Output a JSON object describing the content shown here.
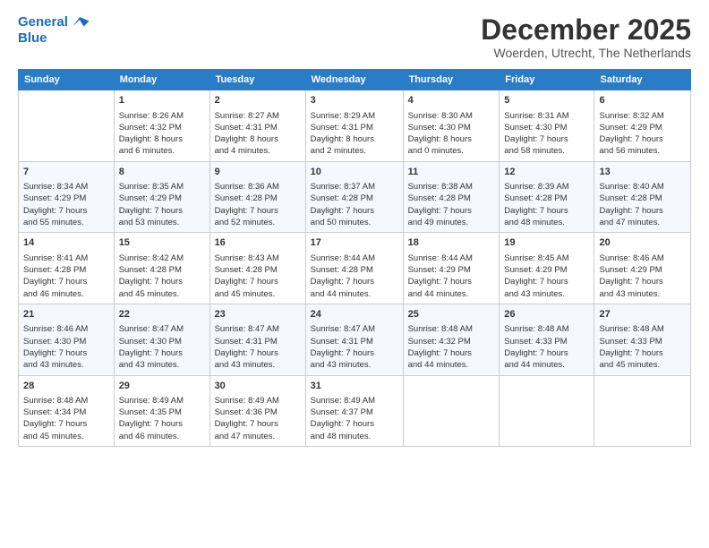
{
  "header": {
    "logo_line1": "General",
    "logo_line2": "Blue",
    "month_title": "December 2025",
    "subtitle": "Woerden, Utrecht, The Netherlands"
  },
  "days_of_week": [
    "Sunday",
    "Monday",
    "Tuesday",
    "Wednesday",
    "Thursday",
    "Friday",
    "Saturday"
  ],
  "weeks": [
    [
      {
        "day": "",
        "info": ""
      },
      {
        "day": "1",
        "info": "Sunrise: 8:26 AM\nSunset: 4:32 PM\nDaylight: 8 hours\nand 6 minutes."
      },
      {
        "day": "2",
        "info": "Sunrise: 8:27 AM\nSunset: 4:31 PM\nDaylight: 8 hours\nand 4 minutes."
      },
      {
        "day": "3",
        "info": "Sunrise: 8:29 AM\nSunset: 4:31 PM\nDaylight: 8 hours\nand 2 minutes."
      },
      {
        "day": "4",
        "info": "Sunrise: 8:30 AM\nSunset: 4:30 PM\nDaylight: 8 hours\nand 0 minutes."
      },
      {
        "day": "5",
        "info": "Sunrise: 8:31 AM\nSunset: 4:30 PM\nDaylight: 7 hours\nand 58 minutes."
      },
      {
        "day": "6",
        "info": "Sunrise: 8:32 AM\nSunset: 4:29 PM\nDaylight: 7 hours\nand 56 minutes."
      }
    ],
    [
      {
        "day": "7",
        "info": "Sunrise: 8:34 AM\nSunset: 4:29 PM\nDaylight: 7 hours\nand 55 minutes."
      },
      {
        "day": "8",
        "info": "Sunrise: 8:35 AM\nSunset: 4:29 PM\nDaylight: 7 hours\nand 53 minutes."
      },
      {
        "day": "9",
        "info": "Sunrise: 8:36 AM\nSunset: 4:28 PM\nDaylight: 7 hours\nand 52 minutes."
      },
      {
        "day": "10",
        "info": "Sunrise: 8:37 AM\nSunset: 4:28 PM\nDaylight: 7 hours\nand 50 minutes."
      },
      {
        "day": "11",
        "info": "Sunrise: 8:38 AM\nSunset: 4:28 PM\nDaylight: 7 hours\nand 49 minutes."
      },
      {
        "day": "12",
        "info": "Sunrise: 8:39 AM\nSunset: 4:28 PM\nDaylight: 7 hours\nand 48 minutes."
      },
      {
        "day": "13",
        "info": "Sunrise: 8:40 AM\nSunset: 4:28 PM\nDaylight: 7 hours\nand 47 minutes."
      }
    ],
    [
      {
        "day": "14",
        "info": "Sunrise: 8:41 AM\nSunset: 4:28 PM\nDaylight: 7 hours\nand 46 minutes."
      },
      {
        "day": "15",
        "info": "Sunrise: 8:42 AM\nSunset: 4:28 PM\nDaylight: 7 hours\nand 45 minutes."
      },
      {
        "day": "16",
        "info": "Sunrise: 8:43 AM\nSunset: 4:28 PM\nDaylight: 7 hours\nand 45 minutes."
      },
      {
        "day": "17",
        "info": "Sunrise: 8:44 AM\nSunset: 4:28 PM\nDaylight: 7 hours\nand 44 minutes."
      },
      {
        "day": "18",
        "info": "Sunrise: 8:44 AM\nSunset: 4:29 PM\nDaylight: 7 hours\nand 44 minutes."
      },
      {
        "day": "19",
        "info": "Sunrise: 8:45 AM\nSunset: 4:29 PM\nDaylight: 7 hours\nand 43 minutes."
      },
      {
        "day": "20",
        "info": "Sunrise: 8:46 AM\nSunset: 4:29 PM\nDaylight: 7 hours\nand 43 minutes."
      }
    ],
    [
      {
        "day": "21",
        "info": "Sunrise: 8:46 AM\nSunset: 4:30 PM\nDaylight: 7 hours\nand 43 minutes."
      },
      {
        "day": "22",
        "info": "Sunrise: 8:47 AM\nSunset: 4:30 PM\nDaylight: 7 hours\nand 43 minutes."
      },
      {
        "day": "23",
        "info": "Sunrise: 8:47 AM\nSunset: 4:31 PM\nDaylight: 7 hours\nand 43 minutes."
      },
      {
        "day": "24",
        "info": "Sunrise: 8:47 AM\nSunset: 4:31 PM\nDaylight: 7 hours\nand 43 minutes."
      },
      {
        "day": "25",
        "info": "Sunrise: 8:48 AM\nSunset: 4:32 PM\nDaylight: 7 hours\nand 44 minutes."
      },
      {
        "day": "26",
        "info": "Sunrise: 8:48 AM\nSunset: 4:33 PM\nDaylight: 7 hours\nand 44 minutes."
      },
      {
        "day": "27",
        "info": "Sunrise: 8:48 AM\nSunset: 4:33 PM\nDaylight: 7 hours\nand 45 minutes."
      }
    ],
    [
      {
        "day": "28",
        "info": "Sunrise: 8:48 AM\nSunset: 4:34 PM\nDaylight: 7 hours\nand 45 minutes."
      },
      {
        "day": "29",
        "info": "Sunrise: 8:49 AM\nSunset: 4:35 PM\nDaylight: 7 hours\nand 46 minutes."
      },
      {
        "day": "30",
        "info": "Sunrise: 8:49 AM\nSunset: 4:36 PM\nDaylight: 7 hours\nand 47 minutes."
      },
      {
        "day": "31",
        "info": "Sunrise: 8:49 AM\nSunset: 4:37 PM\nDaylight: 7 hours\nand 48 minutes."
      },
      {
        "day": "",
        "info": ""
      },
      {
        "day": "",
        "info": ""
      },
      {
        "day": "",
        "info": ""
      }
    ]
  ]
}
